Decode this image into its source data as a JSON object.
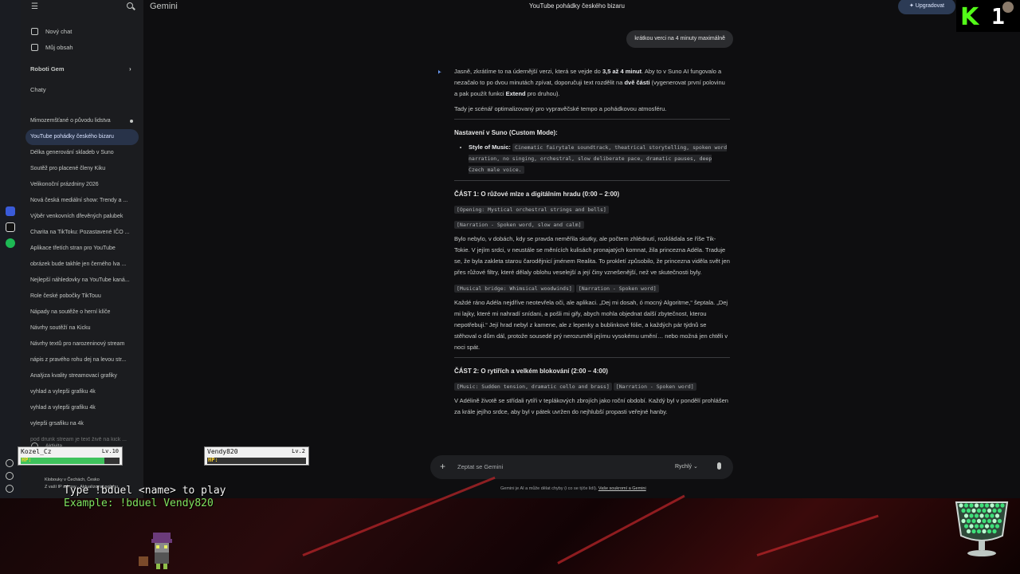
{
  "app": {
    "brand": "Gemini",
    "conversation_title": "YouTube pohádky českého bizaru",
    "upgrade_label": "Upgradovat"
  },
  "sidebar": {
    "new_chat": "Nový chat",
    "my_content": "Můj obsah",
    "gems_label": "Roboti Gem",
    "chats_label": "Chaty",
    "chats": [
      "Mimozemšťané o původu lidstva",
      "YouTube pohádky českého bizaru",
      "Délka generování skladeb v Suno",
      "Soutěž pro placené členy Kiku",
      "Velikonoční prázdniny 2026",
      "Nová česká mediální show: Trendy a ...",
      "Výběr venkovních dřevěných palubek",
      "Charita na TikToku: Pozastavené IČO ...",
      "Aplikace třetích stran pro YouTube",
      "obrázek bude takhle jen černého lva ...",
      "Nejlepší náhledovky na YouTube kaná...",
      "Role české pobočky TikTouu",
      "Nápady na soutěže o herní klíče",
      "Návrhy soutěží na Kicku",
      "Návrhy textů pro narozeninový stream",
      "nápis z pravého rohu dej na levou str...",
      "Analýza kvality streamovací grafiky",
      "vyhlad a vylepši grafiku 4k",
      "vyhlad a vylepši grafiku 4k",
      "vylepši grsafiku na 4k",
      "pod drunk stream je text živě na kick ..."
    ],
    "activity_label": "Aktivita",
    "location_line1": "Klobouky v Čechách, Česko",
    "location_line2": "Z vaší IP adresy · Aktualizovat polohu"
  },
  "chat": {
    "user_message": "krátkou verci na 4 minuty maximálně",
    "answer": {
      "p1_a": "Jasně, zkrátíme to na úderněj­ší verzi, která se vejde do ",
      "p1_b": "3,5 až 4 minut",
      "p1_c": ". Aby to v Suno AI fungovalo a nezačalo to po dvou minutách zpívat, doporučuji text rozdělit na ",
      "p1_d": "dvě části",
      "p1_e": " (vygenerovat první polovinu a pak použít funkci ",
      "p1_f": "Extend",
      "p1_g": " pro druhou).",
      "p2": "Tady je scénář optimalizovaný pro vypravěčské tempo a pohádkovou atmosféru.",
      "settings_heading": "Nastavení v Suno (Custom Mode):",
      "style_label": "Style of Music:",
      "style_code": "Cinematic fairytale soundtrack, theatrical storytelling, spoken word narration, no singing, orchestral, slow deliberate pace, dramatic pauses, deep Czech male voice.",
      "part1_heading": "ČÁST 1: O růžové mlze a digitálním hradu (0:00 – 2:00)",
      "tag_opening": "[Opening: Mystical orchestral strings and bells]",
      "tag_narr1": "[Narration - Spoken word, slow and calm]",
      "story1": "Bylo nebylo, v dobách, kdy se pravda neměřila skutky, ale počtem zhlédnutí, rozkládala se říše Tik-Tokie. V jejím srdci, v neustále se měnících kulisách pronajatých komnat, žila princezna Adéla. Traduje se, že byla zakleta starou čarodějnicí jménem Realita. To prokletí způsobilo, že princezna viděla svět jen přes růžové filtry, které dělaly oblohu veselejší a její činy vznešenější, než ve skutečnosti byly.",
      "tag_bridge": "[Musical bridge: Whimsical woodwinds]",
      "tag_narr2": "[Narration - Spoken word]",
      "story2": "Každé ráno Adéla nejdříve neotevřela oči, ale aplikaci. „Dej mi dosah, ó mocný Algoritme,“ šeptala. „Dej mi lajky, které mi nahradí snídani, a pošli mi gify, abych mohla objednat další zbytečnost, kterou nepotřebuji.“ Její hrad nebyl z kamene, ale z lepenky a bublinkové fólie, a každých pár týdnů se stěhoval o dům dál, protože sousedé prý nerozuměli jejímu vysokému umění… nebo možná jen chtěli v noci spát.",
      "part2_heading": "ČÁST 2: O rytířích a velkém blokování (2:00 – 4:00)",
      "tag_music2": "[Music: Sudden tension, dramatic cello and brass]",
      "tag_narr3": "[Narration - Spoken word]",
      "story3": "V Adélině životě se střídali rytíři v teplákových zbrojích jako roční období. Každý byl v pondělí prohlášen za krále jejího srdce, aby byl v pátek uvržen do nejhlubší propasti veřejné hanby."
    }
  },
  "composer": {
    "placeholder": "Zeptat se Gemini",
    "model_label": "Rychlý",
    "disclaimer": "Gemini je AI a může dělat chyby (i co se týče lidí). ",
    "privacy_link": "Vaše soukromí a Gemini"
  },
  "stream_overlay": {
    "players": [
      {
        "name": "Kozel_Cz",
        "level": "Lv.10",
        "hp_fraction": 0.85
      },
      {
        "name": "Vendy820",
        "level": "Lv.2",
        "hp_fraction": 0.0
      }
    ],
    "hp_label": "HP:",
    "command_line": "Type !bduel <name> to play",
    "example_line": "Example: !bduel Vendy820",
    "kick_letter": "K",
    "kick_number": "1"
  }
}
